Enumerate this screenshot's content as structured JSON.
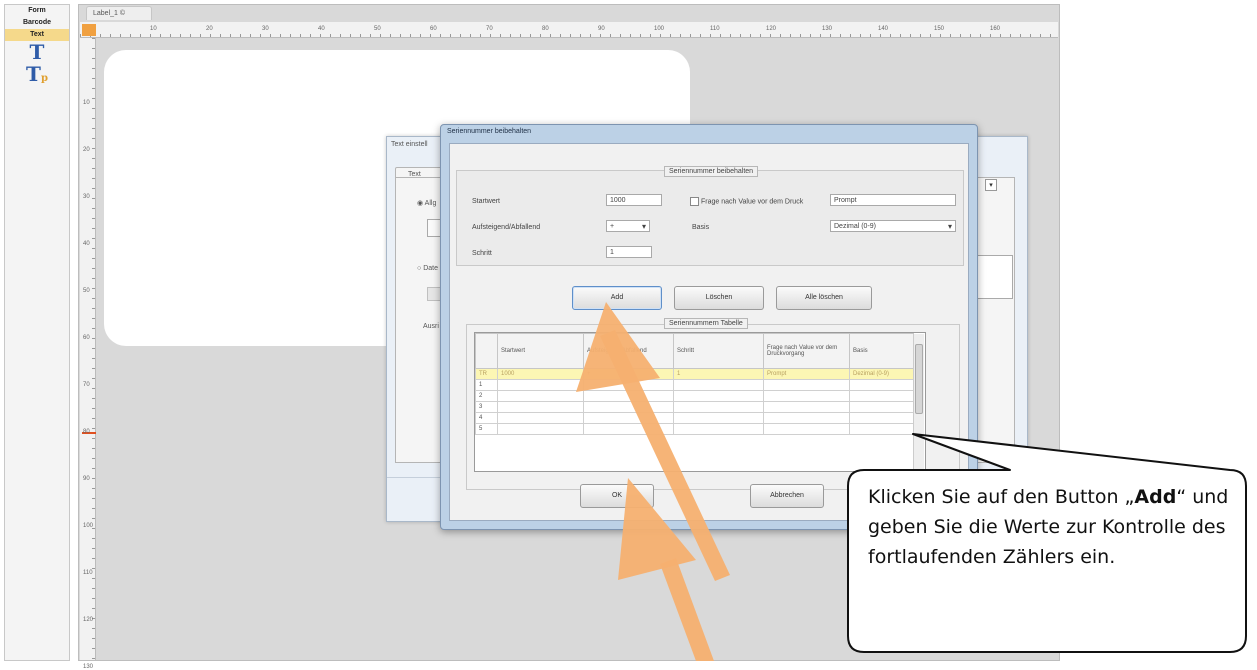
{
  "palette": {
    "items": [
      {
        "label": "Form"
      },
      {
        "label": "Barcode"
      },
      {
        "label": "Text"
      }
    ],
    "icons": [
      "text-tool-icon",
      "text-variable-tool-icon"
    ],
    "active_color": "#f5d98b"
  },
  "document_tab": {
    "label": "Label_1 ©"
  },
  "ruler": {
    "top_numbers": [
      "10",
      "20",
      "30",
      "40",
      "50",
      "60",
      "70",
      "80",
      "90",
      "100",
      "110",
      "120",
      "130",
      "140",
      "150",
      "160"
    ],
    "left_numbers": [
      "10",
      "20",
      "30",
      "40",
      "50",
      "60",
      "70",
      "80",
      "90",
      "100",
      "110",
      "120",
      "130"
    ]
  },
  "bg_dialog": {
    "title": "Text einstell",
    "tab": "Text",
    "radio_1": "Allg",
    "radio_2": "Date",
    "label_3": "Ausri"
  },
  "dialog": {
    "title": "Seriennummer beibehalten",
    "group_settings": "Seriennummer beibehalten",
    "start_label": "Startwert",
    "start_value": "1000",
    "prompt_checkbox_label": "Frage nach Value vor dem Druck",
    "prompt_value": "Prompt",
    "direction_label": "Aufsteigend/Abfallend",
    "direction_value": "+",
    "base_label": "Basis",
    "base_value": "Dezimal (0-9)",
    "step_label": "Schritt",
    "step_value": "1",
    "buttons": {
      "add": "Add",
      "delete": "Löschen",
      "delete_all": "Alle löschen",
      "ok": "OK",
      "cancel": "Abbrechen"
    },
    "group_table": "Seriennummern Tabelle",
    "table": {
      "headers": [
        "",
        "Startwert",
        "Aufsteigend/ Abfallend",
        "Schritt",
        "Frage nach Value vor dem Druckvorgang",
        "Basis"
      ],
      "rows": [
        [
          "TR",
          "1000",
          "+",
          "1",
          "Prompt",
          "Dezimal (0-9)"
        ],
        [
          "1",
          "",
          "",
          "",
          "",
          ""
        ],
        [
          "2",
          "",
          "",
          "",
          "",
          ""
        ],
        [
          "3",
          "",
          "",
          "",
          "",
          ""
        ],
        [
          "4",
          "",
          "",
          "",
          "",
          ""
        ],
        [
          "5",
          "",
          "",
          "",
          "",
          ""
        ]
      ]
    }
  },
  "callout": {
    "text_before": "Klicken Sie auf den Button „",
    "bold": "Add",
    "text_after": "“ und geben Sie die Werte zur Kontrolle des fortlaufenden Zählers ein."
  },
  "colors": {
    "arrow": "#f5b070",
    "highlight_row": "#fcf6b4",
    "ruler_corner": "#f0a040"
  }
}
